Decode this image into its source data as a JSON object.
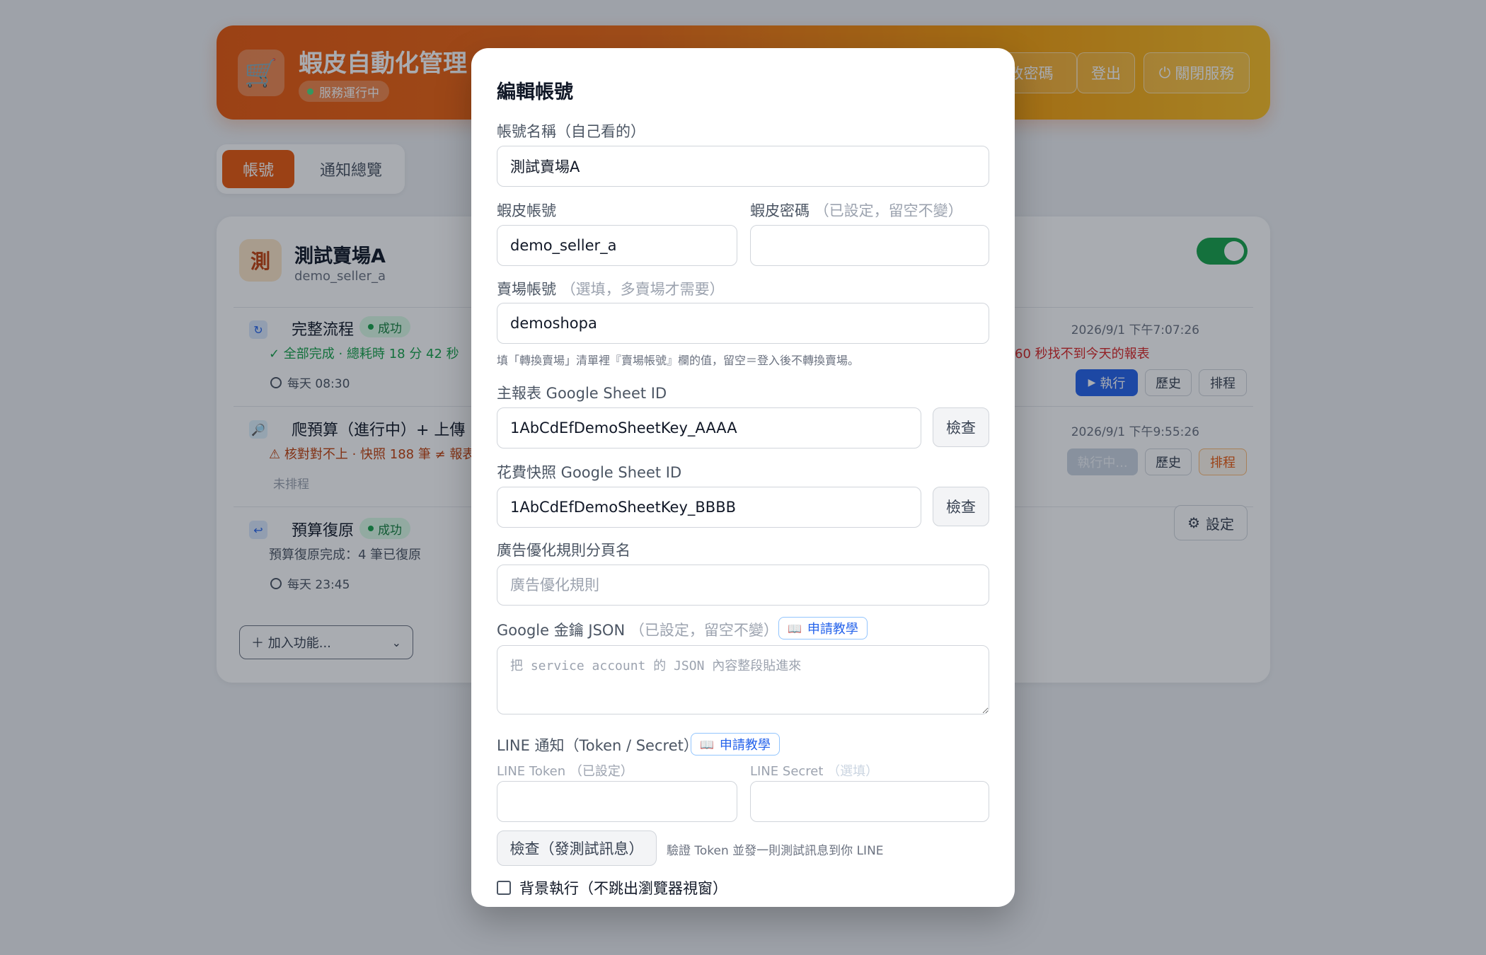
{
  "header": {
    "app_title": "蝦皮自動化管理",
    "status": "服務運行中",
    "change_password": "改密碼",
    "logout": "登出",
    "shutdown": "關閉服務"
  },
  "tabs": [
    {
      "label": "帳號",
      "active": true
    },
    {
      "label": "通知總覽",
      "active": false
    }
  ],
  "account": {
    "avatar": "測",
    "name": "測試賣場A",
    "username": "demo_seller_a",
    "enabled": true,
    "tasks": [
      {
        "name": "完整流程",
        "status": "成功",
        "detail": "✓ 全部完成 · 總耗時 18 分 42 秒",
        "schedule": "每天 08:30",
        "timestamp": "2026/9/1 下午7:07:26",
        "note": "60 秒找不到今天的報表",
        "buttons": [
          "執行",
          "歷史",
          "排程"
        ]
      },
      {
        "name": "爬預算（進行中）+ 上傳 +",
        "detail": "⚠ 核對對不上 · 快照 188 筆 ≠ 報表進",
        "schedule": "未排程",
        "timestamp": "2026/9/1 下午9:55:26",
        "buttons": [
          "執行中...",
          "歷史",
          "排程"
        ]
      },
      {
        "name": "預算復原",
        "status": "成功",
        "detail": "預算復原完成：4 筆已復原",
        "schedule": "每天 23:45"
      }
    ],
    "settings_button": "設定",
    "add_function": "＋ 加入功能..."
  },
  "modal": {
    "title": "編輯帳號",
    "account_name_label": "帳號名稱（自己看的）",
    "account_name_value": "測試賣場A",
    "shopee_account_label": "蝦皮帳號",
    "shopee_account_value": "demo_seller_a",
    "shopee_password_label": "蝦皮密碼",
    "shopee_password_hint": "（已設定，留空不變）",
    "shop_account_label": "賣場帳號",
    "shop_account_hint": "（選填，多賣場才需要）",
    "shop_account_value": "demoshopa",
    "shop_account_help": "填「轉換賣場」清單裡『賣場帳號』欄的值，留空＝登入後不轉換賣場。",
    "main_sheet_label": "主報表 Google Sheet ID",
    "main_sheet_value": "1AbCdEfDemoSheetKey_AAAA",
    "check_label": "檢查",
    "cost_sheet_label": "花費快照 Google Sheet ID",
    "cost_sheet_value": "1AbCdEfDemoSheetKey_BBBB",
    "ad_rule_label": "廣告優化規則分頁名",
    "ad_rule_placeholder": "廣告優化規則",
    "google_key_label": "Google 金鑰 JSON",
    "google_key_hint": "（已設定，留空不變）",
    "tutorial_label": "申請教學",
    "google_key_placeholder": "把 service account 的 JSON 內容整段貼進來",
    "line_label": "LINE 通知（Token / Secret）",
    "line_token_label": "LINE Token",
    "line_token_hint": "（已設定）",
    "line_secret_label": "LINE Secret",
    "line_secret_hint": "（選填）",
    "test_button": "檢查（發測試訊息）",
    "test_help": "驗證 Token 並發一則測試訊息到你 LINE",
    "background_label": "背景執行（不跳出瀏覽器視窗）"
  }
}
